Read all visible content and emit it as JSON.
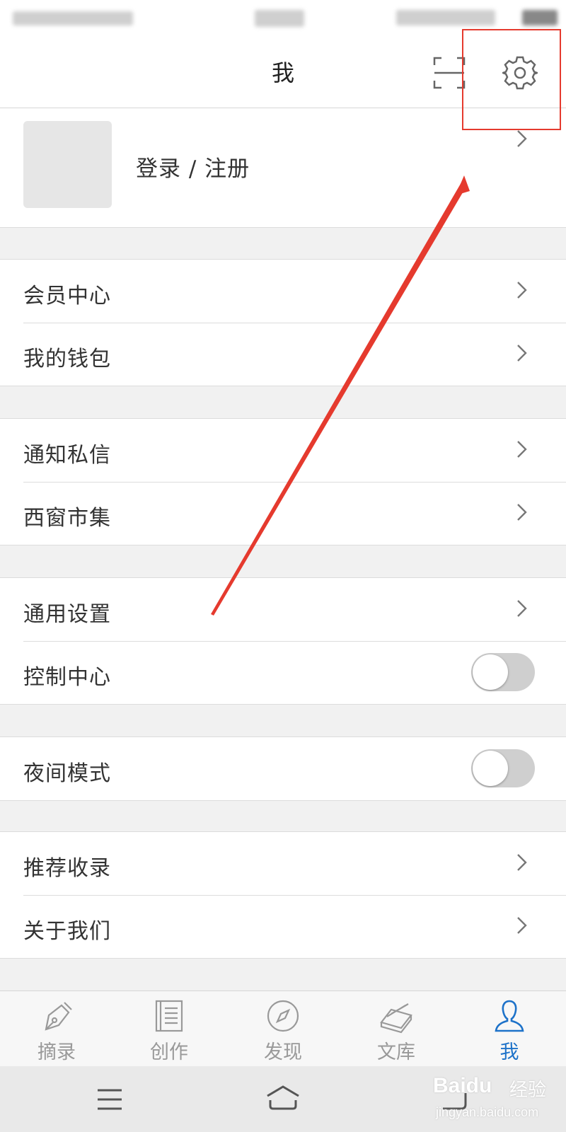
{
  "header": {
    "title": "我"
  },
  "profile": {
    "login_label": "登录 / 注册"
  },
  "groups": [
    {
      "items": [
        {
          "label": "会员中心",
          "type": "chevron"
        },
        {
          "label": "我的钱包",
          "type": "chevron"
        }
      ]
    },
    {
      "items": [
        {
          "label": "通知私信",
          "type": "chevron"
        },
        {
          "label": "西窗市集",
          "type": "chevron"
        }
      ]
    },
    {
      "items": [
        {
          "label": "通用设置",
          "type": "chevron"
        },
        {
          "label": "控制中心",
          "type": "toggle",
          "on": false
        }
      ]
    },
    {
      "items": [
        {
          "label": "夜间模式",
          "type": "toggle",
          "on": false
        }
      ]
    },
    {
      "items": [
        {
          "label": "推荐收录",
          "type": "chevron"
        },
        {
          "label": "关于我们",
          "type": "chevron"
        }
      ]
    }
  ],
  "tabbar": {
    "tabs": [
      {
        "label": "摘录",
        "icon": "pen-icon"
      },
      {
        "label": "创作",
        "icon": "document-icon"
      },
      {
        "label": "发现",
        "icon": "compass-icon"
      },
      {
        "label": "文库",
        "icon": "books-icon"
      },
      {
        "label": "我",
        "icon": "person-icon",
        "active": true
      }
    ]
  },
  "watermark": {
    "brand": "Baidu",
    "cn": "经验",
    "url": "jingyan.baidu.com"
  },
  "colors": {
    "accent": "#1d72c9",
    "annotation": "#e53a2e",
    "background": "#f1f1f1"
  }
}
